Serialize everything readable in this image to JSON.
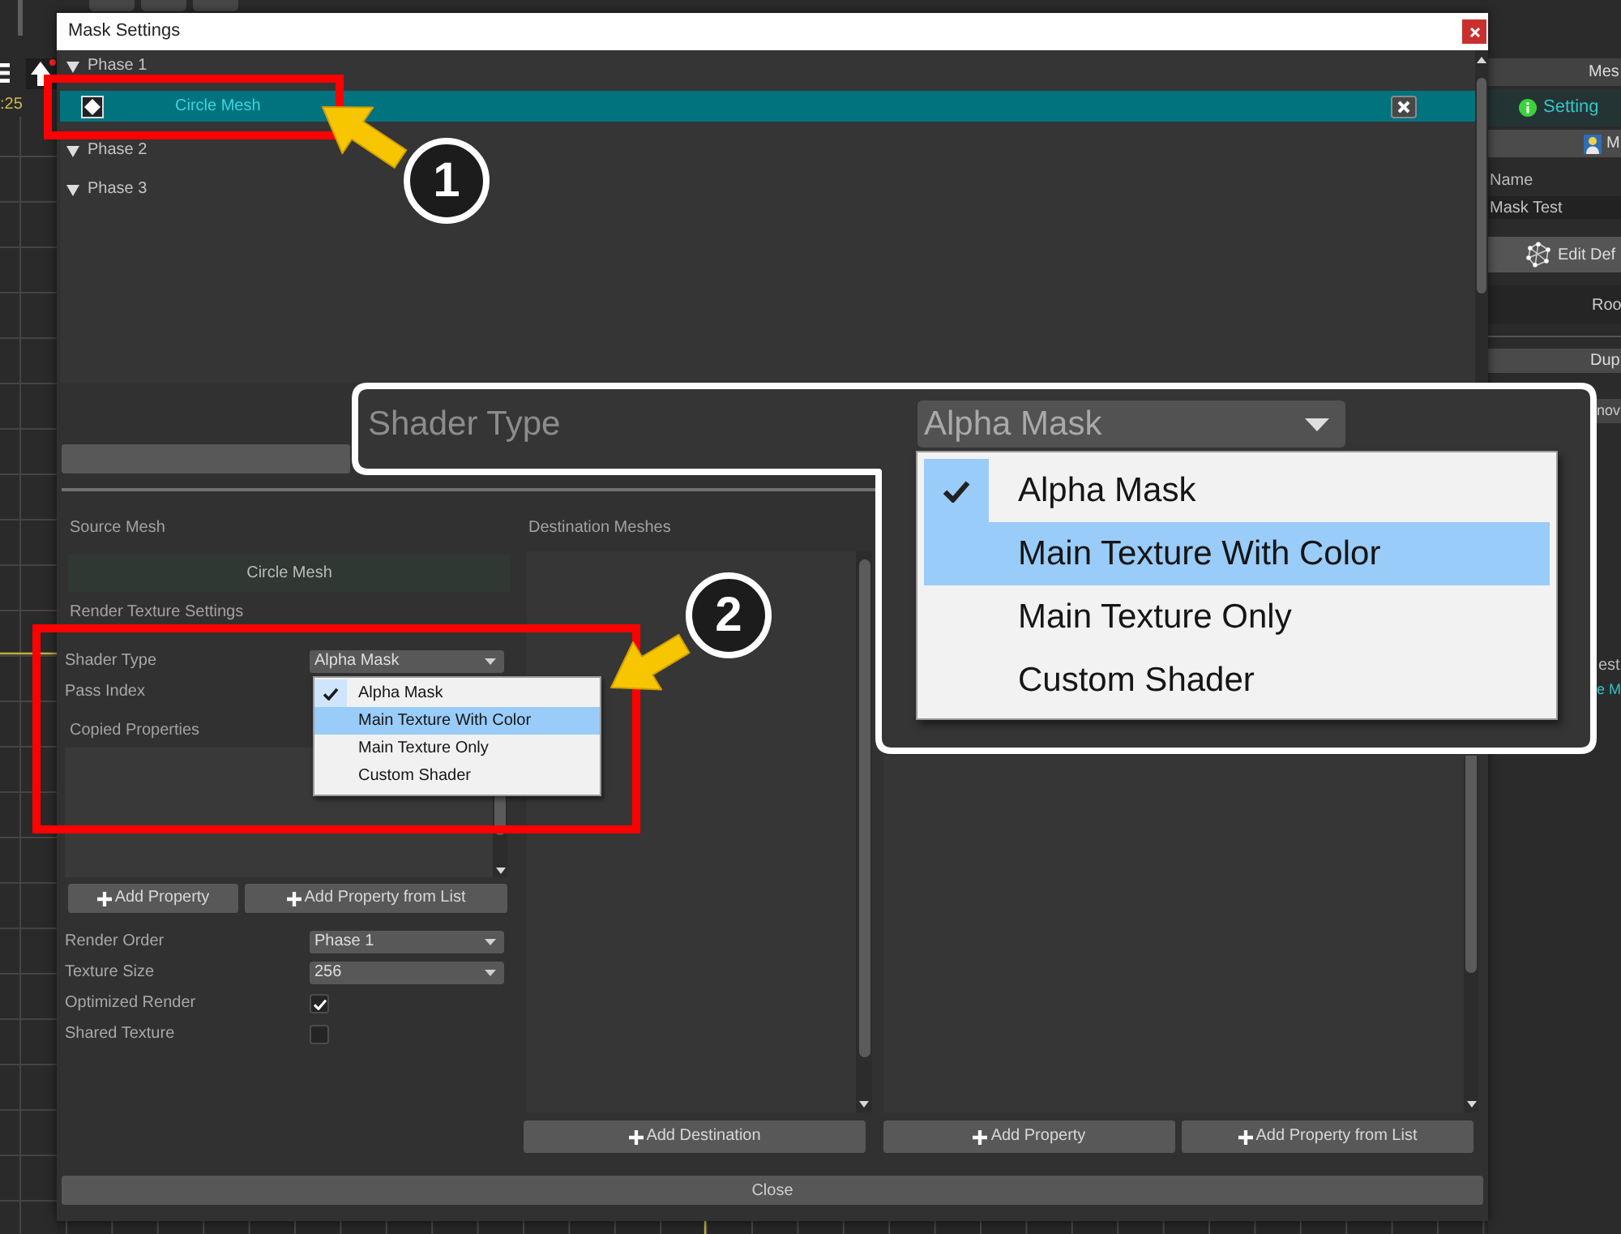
{
  "background": {
    "timeline": {
      "time_label": ":25"
    },
    "inspector": {
      "header": "Mes",
      "tab": "Setting",
      "button_1": "M",
      "label": "Name",
      "field_value": "Mask Test",
      "button_2": "Edit Def",
      "button_3": "Roo",
      "button_4": "Dup",
      "button_5": "nov",
      "text_1": "est",
      "text_2": "e M"
    }
  },
  "dialog": {
    "title": "Mask Settings",
    "tree": [
      {
        "label": "Phase 1",
        "expanded": true,
        "children": [
          {
            "label": "Circle Mesh",
            "selected": true
          }
        ]
      },
      {
        "label": "Phase 2",
        "expanded": true
      },
      {
        "label": "Phase 3",
        "expanded": true
      }
    ],
    "source_mesh": {
      "label": "Source Mesh",
      "value": "Circle Mesh"
    },
    "render_texture_settings": {
      "title": "Render Texture Settings",
      "fields": [
        {
          "kind": "dropdown",
          "label": "Shader Type",
          "value": "Alpha Mask"
        },
        {
          "kind": "label",
          "label": "Pass Index"
        }
      ]
    },
    "copied_properties": {
      "label": "Copied Properties",
      "buttons": [
        "Add Property",
        "Add Property from List"
      ]
    },
    "options": [
      {
        "kind": "dropdown",
        "label": "Render Order",
        "value": "Phase 1"
      },
      {
        "kind": "dropdown",
        "label": "Texture Size",
        "value": "256"
      },
      {
        "kind": "checkbox",
        "label": "Optimized Render",
        "checked": true
      },
      {
        "kind": "checkbox",
        "label": "Shared Texture",
        "checked": false
      }
    ],
    "destination_meshes": {
      "label": "Destination Meshes",
      "button": "Add Destination"
    },
    "column_3": {
      "buttons": [
        "Add Property",
        "Add Property from List"
      ]
    },
    "shader_menu": [
      {
        "label": "Alpha Mask",
        "selected": true,
        "highlighted": false
      },
      {
        "label": "Main Texture With Color",
        "selected": false,
        "highlighted": true
      },
      {
        "label": "Main Texture Only",
        "selected": false,
        "highlighted": false
      },
      {
        "label": "Custom Shader",
        "selected": false,
        "highlighted": false
      }
    ],
    "close_button": "Close"
  },
  "zoom_inset": {
    "label": "Shader Type",
    "value": "Alpha Mask",
    "menu": [
      {
        "label": "Alpha Mask",
        "selected": true,
        "highlighted": false
      },
      {
        "label": "Main Texture With Color",
        "selected": false,
        "highlighted": true
      },
      {
        "label": "Main Texture Only",
        "selected": false,
        "highlighted": false
      },
      {
        "label": "Custom Shader",
        "selected": false,
        "highlighted": false
      }
    ]
  },
  "callouts": [
    {
      "number": "1"
    },
    {
      "number": "2"
    }
  ]
}
